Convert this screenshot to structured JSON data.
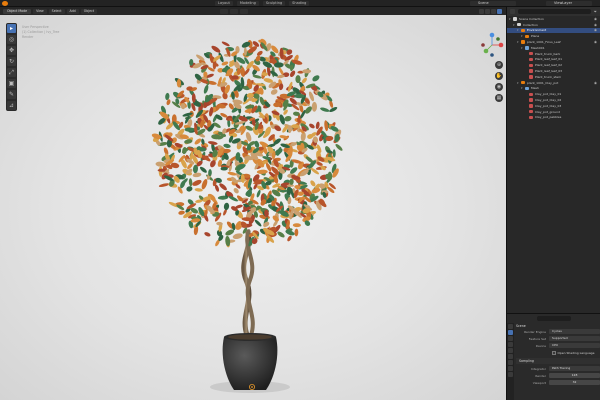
{
  "topbar": {
    "workspace_tabs": [
      "Layout",
      "Modeling",
      "Sculpting",
      "Shading"
    ],
    "scene": "Scene",
    "view_layer": "ViewLayer"
  },
  "viewport": {
    "mode": "Object Mode",
    "menus": [
      "View",
      "Select",
      "Add",
      "Object"
    ],
    "transform": "Global",
    "info_lines": [
      "User Perspective",
      "(1) Collection | Ivy_Tree",
      "Render"
    ]
  },
  "outliner": {
    "search_placeholder": "",
    "rows": [
      {
        "label": "Scene Collection",
        "indent": 0,
        "color": "#d4d4d4",
        "selected": false
      },
      {
        "label": "Collection",
        "indent": 1,
        "color": "#d4d4d4",
        "selected": false
      },
      {
        "label": "Environment",
        "indent": 2,
        "color": "#e87d0d",
        "selected": true
      },
      {
        "label": "Plane",
        "indent": 3,
        "color": "#e87d0d",
        "selected": false
      },
      {
        "label": "plant_1001_Ficus_Leaf",
        "indent": 2,
        "color": "#e87d0d",
        "selected": false
      },
      {
        "label": "Mesh001",
        "indent": 3,
        "color": "#6fa3d8",
        "selected": false
      },
      {
        "label": "Plant_trunk_bark",
        "indent": 4,
        "color": "#c84f4f",
        "selected": false
      },
      {
        "label": "Plant_leaf_leaf_01",
        "indent": 4,
        "color": "#c84f4f",
        "selected": false
      },
      {
        "label": "Plant_leaf_leaf_02",
        "indent": 4,
        "color": "#c84f4f",
        "selected": false
      },
      {
        "label": "Plant_leaf_leaf_03",
        "indent": 4,
        "color": "#c84f4f",
        "selected": false
      },
      {
        "label": "Plant_trunk_stem",
        "indent": 4,
        "color": "#c84f4f",
        "selected": false
      },
      {
        "label": "plant_1001_Clay_pot",
        "indent": 2,
        "color": "#e87d0d",
        "selected": false
      },
      {
        "label": "Mesh",
        "indent": 3,
        "color": "#6fa3d8",
        "selected": false
      },
      {
        "label": "Clay_pot_Clay_01",
        "indent": 4,
        "color": "#c84f4f",
        "selected": false
      },
      {
        "label": "Clay_pot_Clay_02",
        "indent": 4,
        "color": "#c84f4f",
        "selected": false
      },
      {
        "label": "Clay_pot_Clay_03",
        "indent": 4,
        "color": "#c84f4f",
        "selected": false
      },
      {
        "label": "Clay_pot_ground",
        "indent": 4,
        "color": "#c84f4f",
        "selected": false
      },
      {
        "label": "Clay_pot_pebbles",
        "indent": 4,
        "color": "#c84f4f",
        "selected": false
      }
    ]
  },
  "properties": {
    "panel_title": "Scene",
    "rows": [
      {
        "label": "Render Engine",
        "value": "Cycles"
      },
      {
        "label": "Feature Set",
        "value": "Supported"
      },
      {
        "label": "Device",
        "value": "CPU"
      }
    ],
    "checkbox_label": "Open Shading Language",
    "section": "Sampling",
    "integrator": {
      "label": "Integrator",
      "value": "Path Tracing"
    },
    "render": {
      "label": "Render",
      "value": "128"
    },
    "viewport": {
      "label": "Viewport",
      "value": "32"
    }
  }
}
